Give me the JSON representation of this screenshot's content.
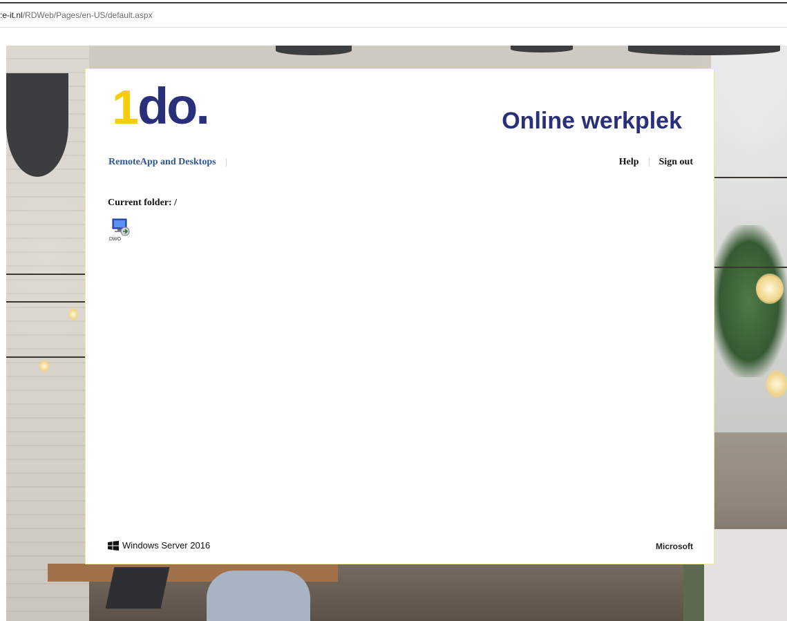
{
  "browser": {
    "url_host": ":e-it.nl",
    "url_path": "/RDWeb/Pages/en-US/default.aspx"
  },
  "card": {
    "logo": {
      "one": "1",
      "do": "do."
    },
    "title": "Online werkplek",
    "nav": {
      "remoteapp_label": "RemoteApp and Desktops"
    },
    "links": {
      "help": "Help",
      "signout": "Sign out"
    },
    "current_folder": "Current folder: /",
    "apps": [
      {
        "label": "DWO",
        "icon": "remote-desktop-icon"
      }
    ],
    "footer": {
      "product": "Windows Server 2016",
      "product_icon": "windows-logo-icon",
      "vendor": "Microsoft"
    }
  },
  "colors": {
    "brand_navy": "#2a2f7a",
    "brand_yellow": "#f5cd0b",
    "nav_link": "#2f5597"
  }
}
